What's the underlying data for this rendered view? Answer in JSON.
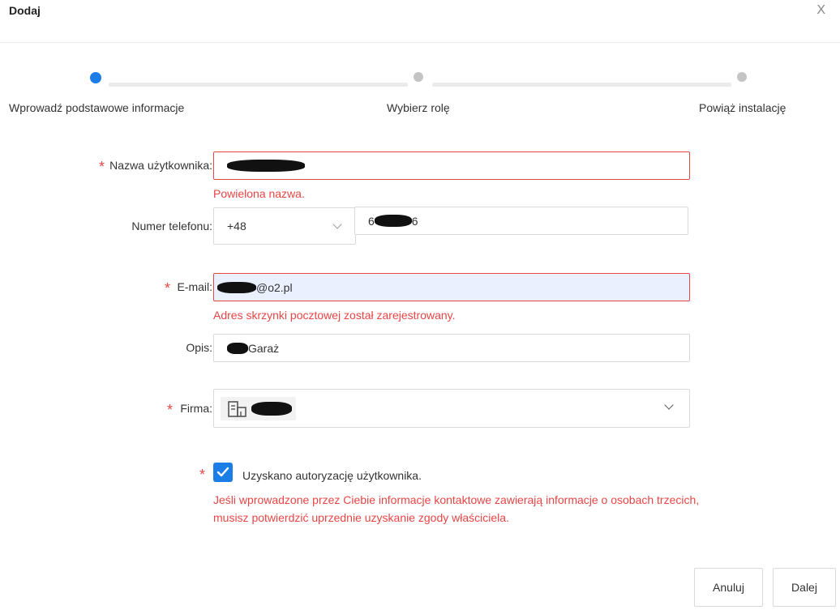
{
  "dialog": {
    "title": "Dodaj",
    "close_label": "X"
  },
  "steps": [
    {
      "label": "Wprowadź podstawowe informacje",
      "state": "active"
    },
    {
      "label": "Wybierz rolę",
      "state": "inactive"
    },
    {
      "label": "Powiąż instalację",
      "state": "inactive"
    }
  ],
  "form": {
    "username": {
      "label": "Nazwa użytkownika:",
      "required": "*",
      "error": "Powielona nazwa."
    },
    "phone": {
      "label": "Numer telefonu:",
      "country_code": "+48",
      "value_prefix": "6",
      "value_suffix": "6"
    },
    "email": {
      "label": "E-mail:",
      "required": "*",
      "value_suffix": "@o2.pl",
      "error": "Adres skrzynki pocztowej został zarejestrowany."
    },
    "description": {
      "label": "Opis:",
      "value_suffix": "Garaż"
    },
    "company": {
      "label": "Firma:",
      "required": "*"
    },
    "authorization": {
      "required": "*",
      "label": "Uzyskano autoryzację użytkownika.",
      "checked": true,
      "warning_line1": "Jeśli wprowadzone przez Ciebie informacje kontaktowe zawierają informacje o osobach trzecich,",
      "warning_line2": "musisz potwierdzić uprzednie uzyskanie zgody właściciela."
    }
  },
  "buttons": {
    "cancel": "Anuluj",
    "next": "Dalej"
  },
  "colors": {
    "accent": "#1a7ee6",
    "error": "#e84545",
    "autofill": "#eaf0fd"
  },
  "icons": {
    "company": "building-icon",
    "checkbox": "checkmark-icon",
    "chevron": "chevron-down-icon"
  }
}
